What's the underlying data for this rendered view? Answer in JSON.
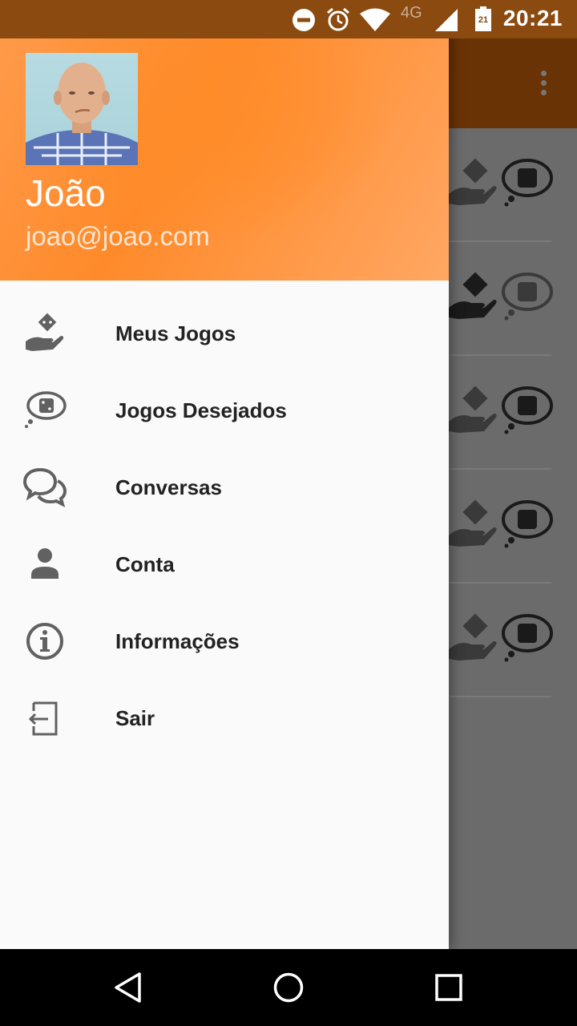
{
  "status_bar": {
    "time": "20:21",
    "network": "4G",
    "battery_level": "21",
    "icons": [
      "do-not-disturb-icon",
      "alarm-icon",
      "wifi-icon",
      "signal-icon",
      "battery-icon"
    ]
  },
  "drawer": {
    "user": {
      "name": "João",
      "email": "joao@joao.com"
    },
    "items": [
      {
        "label": "Meus Jogos",
        "icon": "hand-dice-icon"
      },
      {
        "label": "Jogos Desejados",
        "icon": "thought-dice-icon"
      },
      {
        "label": "Conversas",
        "icon": "chat-icon"
      },
      {
        "label": "Conta",
        "icon": "person-icon"
      },
      {
        "label": "Informações",
        "icon": "info-icon"
      },
      {
        "label": "Sair",
        "icon": "exit-icon"
      }
    ]
  },
  "colors": {
    "header_orange": "#ff8a2a",
    "status_bar": "#8a4a10",
    "scrim": "#6b6b6b",
    "icon_gray": "#616161"
  },
  "navigation": [
    "back-icon",
    "home-icon",
    "recents-icon"
  ]
}
